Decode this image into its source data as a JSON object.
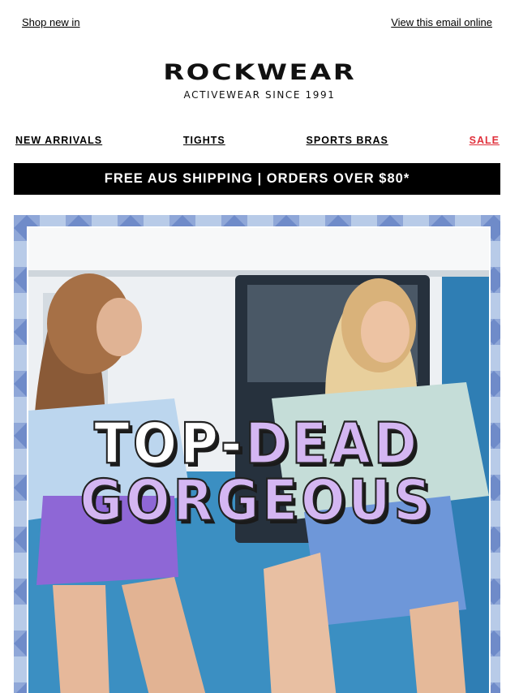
{
  "preheader": {
    "shop_new_in": "Shop new in",
    "view_online": "View this email online"
  },
  "logo": {
    "brand": "ROCKWEAR",
    "tagline": "ACTIVEWEAR SINCE 1991"
  },
  "nav": {
    "items": [
      "NEW ARRIVALS",
      "TIGHTS",
      "SPORTS BRAS",
      "SALE"
    ]
  },
  "shipping_banner": {
    "text": "FREE AUS SHIPPING | ORDERS OVER $80*"
  },
  "hero": {
    "headline_part1": "TOP-",
    "headline_part2": "DEAD",
    "headline_line2": "GORGEOUS"
  },
  "colors": {
    "sale": "#e0303b",
    "banner_bg": "#000000",
    "hero_frame": "#b6c8e6",
    "headline_accent": "#d4b6f2"
  }
}
